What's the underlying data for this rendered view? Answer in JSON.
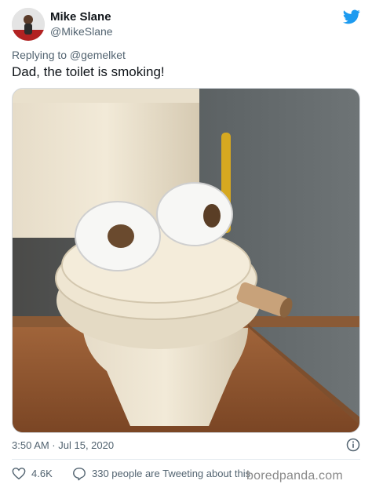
{
  "author": {
    "name": "Mike Slane",
    "handle": "@MikeSlane"
  },
  "reply_to": "Replying to @gemelket",
  "tweet_text": "Dad, the toilet is smoking!",
  "media": {
    "description_icon": "photo"
  },
  "meta": {
    "timestamp": "3:50 AM · Jul 15, 2020"
  },
  "actions": {
    "likes": "4.6K",
    "tweeting": "330 people are Tweeting about this"
  },
  "watermark": "boredpanda.com",
  "colors": {
    "twitter_blue": "#1d9bf0",
    "secondary_text": "#536471"
  }
}
